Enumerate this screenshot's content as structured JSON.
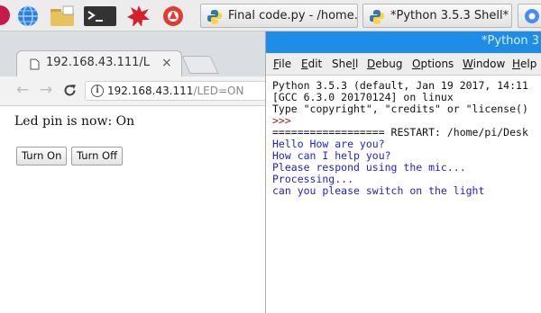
{
  "taskbar": {
    "tasks": [
      {
        "label": "Final code.py - /home..."
      },
      {
        "label": "*Python 3.5.3 Shell*"
      }
    ]
  },
  "browser": {
    "tab_title": "192.168.43.111/LE",
    "tab_close": "×",
    "url_host": "192.168.43.111",
    "url_path": "/LED=ON",
    "page_text": "Led pin is now: On",
    "btn_on": "Turn On",
    "btn_off": "Turn Off"
  },
  "shell": {
    "title": "*Python 3",
    "menus": [
      {
        "u": "F",
        "rest": "ile"
      },
      {
        "u": "E",
        "rest": "dit"
      },
      {
        "pre": "She",
        "u": "l",
        "rest": "l"
      },
      {
        "u": "D",
        "rest": "ebug"
      },
      {
        "u": "O",
        "rest": "ptions"
      },
      {
        "u": "W",
        "rest": "indow"
      },
      {
        "u": "H",
        "rest": "elp"
      }
    ],
    "lines": [
      "Python 3.5.3 (default, Jan 19 2017, 14:11",
      "[GCC 6.3.0 20170124] on linux",
      "Type \"copyright\", \"credits\" or \"license()",
      ">>> ",
      "================== RESTART: /home/pi/Desk",
      "Hello How are you?",
      "How can I help you?",
      "Please respond using the mic...",
      "Processing...",
      "can you please switch on the light"
    ],
    "prompt": ">>>"
  }
}
